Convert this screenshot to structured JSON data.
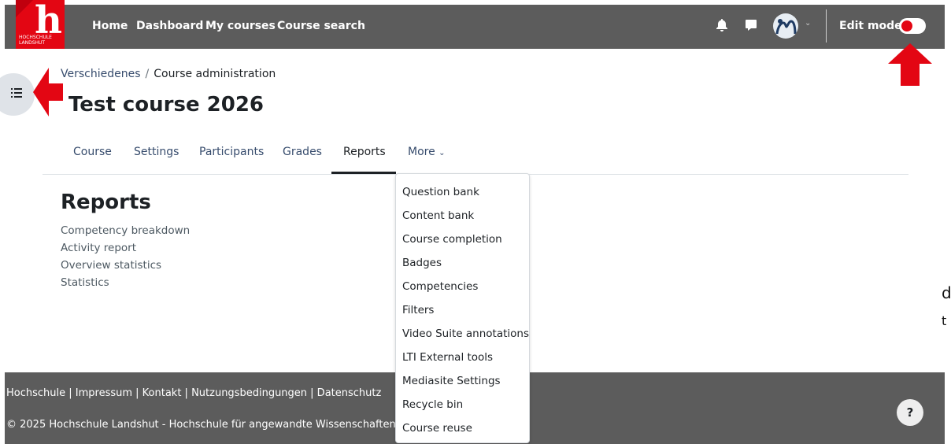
{
  "navbar": {
    "logo_text": "HOCHSCHULE LANDSHUT",
    "links": [
      "Home",
      "Dashboard",
      "My courses",
      "Course search"
    ],
    "edit_mode_label": "Edit mode",
    "edit_mode_on": false
  },
  "breadcrumb": {
    "parent": "Verschiedenes",
    "separator": "/",
    "current": "Course administration"
  },
  "page_title": "Test course 2026",
  "tabs": [
    "Course",
    "Settings",
    "Participants",
    "Grades",
    "Reports",
    "More"
  ],
  "active_tab": "Reports",
  "reports": {
    "heading": "Reports",
    "links": [
      "Competency breakdown",
      "Activity report",
      "Overview statistics",
      "Statistics"
    ]
  },
  "more_menu": {
    "items": [
      "Question bank",
      "Content bank",
      "Course completion",
      "Badges",
      "Competencies",
      "Filters",
      "Video Suite annotations",
      "LTI External tools",
      "Mediasite Settings",
      "Recycle bin",
      "Course reuse"
    ]
  },
  "footer": {
    "links": "Hochschule | Impressum | Kontakt | Nutzungsbedingungen | Datenschutz",
    "copyright": "© 2025 Hochschule Landshut - Hochschule für angewandte Wissenschaften",
    "help_label": "?"
  },
  "stray_text": [
    "d",
    "t"
  ],
  "colors": {
    "navbar": "#5c5c5c",
    "brand_red": "#e30613",
    "link": "#374c6d"
  }
}
